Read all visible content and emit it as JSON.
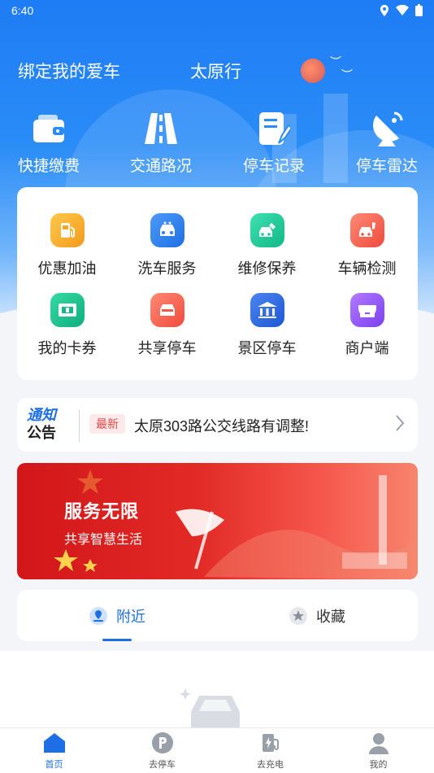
{
  "status_bar": {
    "time": "6:40"
  },
  "header": {
    "bind_car": "绑定我的爱车",
    "city": "太原行"
  },
  "quick_actions": [
    {
      "label": "快捷缴费",
      "icon": "wallet-icon"
    },
    {
      "label": "交通路况",
      "icon": "road-icon"
    },
    {
      "label": "停车记录",
      "icon": "document-edit-icon"
    },
    {
      "label": "停车雷达",
      "icon": "radar-dish-icon"
    }
  ],
  "services": [
    {
      "label": "优惠加油",
      "icon": "fuel-icon",
      "color": "#f6a623"
    },
    {
      "label": "洗车服务",
      "icon": "car-wash-icon",
      "color": "#2f7cf0"
    },
    {
      "label": "维修保养",
      "icon": "repair-icon",
      "color": "#1fc89a"
    },
    {
      "label": "车辆检测",
      "icon": "inspection-icon",
      "color": "#f2584a"
    },
    {
      "label": "我的卡券",
      "icon": "coupon-icon",
      "color": "#14b98a"
    },
    {
      "label": "共享停车",
      "icon": "shared-parking-icon",
      "color": "#f05a4a"
    },
    {
      "label": "景区停车",
      "icon": "scenic-parking-icon",
      "color": "#2f6fe5"
    },
    {
      "label": "商户端",
      "icon": "merchant-icon",
      "color": "#8d55f2"
    }
  ],
  "notice": {
    "logo_line1": "通知",
    "logo_line2": "公告",
    "badge": "最新",
    "text": "太原303路公交线路有调整!"
  },
  "banner": {
    "title": "服务无限",
    "subtitle": "共享智慧生活"
  },
  "tabs": [
    {
      "label": "附近",
      "icon": "location-person-icon",
      "active": true
    },
    {
      "label": "收藏",
      "icon": "star-icon",
      "active": false
    }
  ],
  "nav": [
    {
      "label": "首页",
      "icon": "home-icon",
      "active": true
    },
    {
      "label": "去停车",
      "icon": "parking-icon",
      "active": false
    },
    {
      "label": "去充电",
      "icon": "charging-station-icon",
      "active": false
    },
    {
      "label": "我的",
      "icon": "user-icon",
      "active": false
    }
  ],
  "colors": {
    "primary": "#1e6fe5",
    "hero_top": "#1e7cf5"
  }
}
